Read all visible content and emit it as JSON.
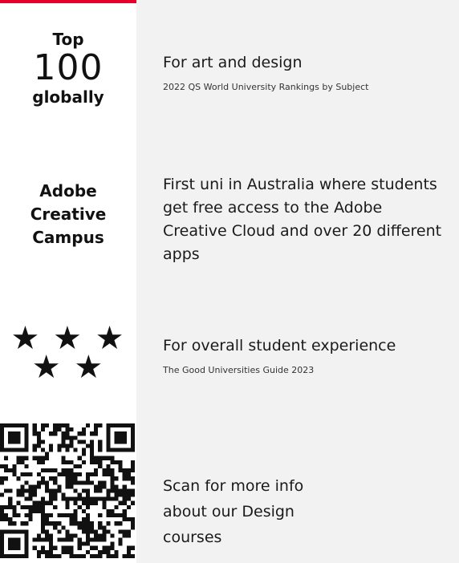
{
  "accent_color": "#e4002b",
  "panel_color": "#f2f2f2",
  "stats": {
    "ranking": {
      "top": "Top",
      "number": "100",
      "bottom": "globally"
    },
    "adobe": {
      "line1": "Adobe",
      "line2": "Creative",
      "line3": "Campus"
    },
    "stars": {
      "icon": "star-icon",
      "rating": 5,
      "line1": "★ ★ ★",
      "line2": "★ ★"
    },
    "qr": {
      "icon": "qr-code-icon"
    }
  },
  "rows": {
    "art_design": {
      "title": "For art and design",
      "source": "2022 QS World University Rankings by Subject"
    },
    "adobe": {
      "title": "First uni in Australia where students get free access to the Adobe Creative Cloud and over 20 different apps"
    },
    "experience": {
      "title": "For overall student experience",
      "source": "The Good Universities Guide 2023"
    },
    "scan": {
      "title": "Scan for more info about our Design courses"
    }
  }
}
